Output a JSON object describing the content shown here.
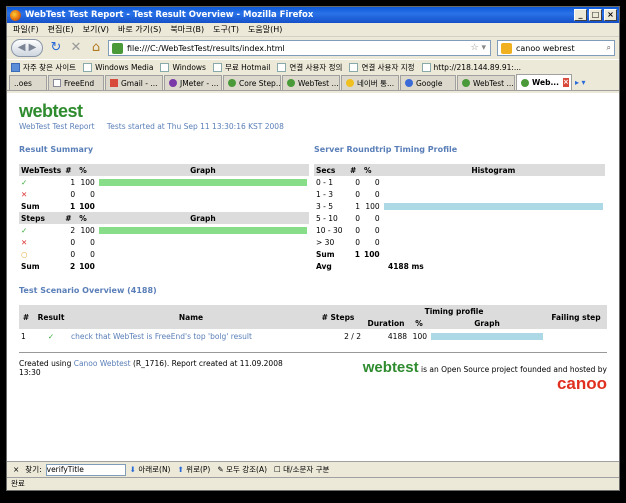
{
  "window": {
    "title": "WebTest Test Report - Test Result Overview - Mozilla Firefox",
    "min": "_",
    "max": "□",
    "close": "×"
  },
  "menu": [
    "파일(F)",
    "편집(E)",
    "보기(V)",
    "바로 가기(S)",
    "북마크(B)",
    "도구(T)",
    "도움말(H)"
  ],
  "nav": {
    "url": "file:///C:/WebTestTest/results/index.html",
    "search_value": "canoo webrest"
  },
  "bookmarks": [
    "자주 찾은 사이트",
    "Windows Media",
    "Windows",
    "무료 Hotmail",
    "연결 사용자 정의",
    "연결 사용자 지정",
    "http://218.144.89.91:..."
  ],
  "tabs": [
    {
      "label": "..oes"
    },
    {
      "label": "FreeEnd"
    },
    {
      "label": "Gmail - ..."
    },
    {
      "label": "JMeter - ..."
    },
    {
      "label": "Core Step..."
    },
    {
      "label": "WebTest ..."
    },
    {
      "label": "네이버 통..."
    },
    {
      "label": "Google"
    },
    {
      "label": "WebTest ..."
    },
    {
      "label": "Web..."
    }
  ],
  "report": {
    "logo_main": "webtest",
    "subtitle": "WebTest Test Report",
    "started": "Tests started at Thu Sep 11 13:30:16 KST 2008",
    "result_summary": "Result Summary",
    "server_profile": "Server Roundtrip Timing Profile",
    "webtests_table": {
      "headers": [
        "WebTests",
        "#",
        "%",
        "Graph"
      ],
      "rows": [
        {
          "icon": "✓",
          "count": "1",
          "pct": "100",
          "fill": 1.0
        },
        {
          "icon": "✕",
          "count": "0",
          "pct": "0",
          "fill": 0
        },
        {
          "label": "Sum",
          "count": "1",
          "pct": "100"
        }
      ]
    },
    "steps_table": {
      "headers": [
        "Steps",
        "#",
        "%",
        "Graph"
      ],
      "rows": [
        {
          "icon": "✓",
          "count": "2",
          "pct": "100",
          "fill": 1.0
        },
        {
          "icon": "✕",
          "count": "0",
          "pct": "0",
          "fill": 0
        },
        {
          "icon": "○",
          "count": "0",
          "pct": "0",
          "fill": 0
        },
        {
          "label": "Sum",
          "count": "2",
          "pct": "100"
        }
      ]
    },
    "timing_table": {
      "headers": [
        "Secs",
        "#",
        "%",
        "Histogram"
      ],
      "rows": [
        {
          "range": "0 - 1",
          "count": "0",
          "pct": "0",
          "fill": 0
        },
        {
          "range": "1 - 3",
          "count": "0",
          "pct": "0",
          "fill": 0
        },
        {
          "range": "3 - 5",
          "count": "1",
          "pct": "100",
          "fill": 1.0
        },
        {
          "range": "5 - 10",
          "count": "0",
          "pct": "0",
          "fill": 0
        },
        {
          "range": "10 - 30",
          "count": "0",
          "pct": "0",
          "fill": 0
        },
        {
          "range": "> 30",
          "count": "0",
          "pct": "0",
          "fill": 0
        },
        {
          "range": "Sum",
          "count": "1",
          "pct": "100"
        },
        {
          "range": "Avg",
          "avg": "4188 ms"
        }
      ]
    },
    "scenario": {
      "title": "Test Scenario Overview (4188)",
      "headers": {
        "num": "#",
        "result": "Result",
        "name": "Name",
        "steps": "# Steps",
        "timing": "Timing profile",
        "duration": "Duration",
        "pct": "%",
        "graph": "Graph",
        "failing": "Failing step"
      },
      "row": {
        "num": "1",
        "result": "✓",
        "name": "check that WebTest is FreeEnd's top 'bolg' result",
        "steps": "2 / 2",
        "duration": "4188",
        "pct": "100",
        "fill": 1.0,
        "failing": ""
      }
    },
    "footer": {
      "created_using": "Created using ",
      "webtest_link": "Canoo Webtest",
      "created_rest": " (R_1716). Report created at 11.09.2008",
      "created_time": "13:30",
      "brand_webtest": "webtest",
      "brand_text": "is an Open Source project founded and hosted by",
      "brand_canoo": "canoo"
    }
  },
  "findbar": {
    "close": "×",
    "label": "찾기:",
    "value": "verifyTitle",
    "next": "아래로(N)",
    "prev": "위로(P)",
    "highlight": "모두 강조(A)",
    "matchcase": "대/소문자 구분"
  },
  "status": "완료"
}
